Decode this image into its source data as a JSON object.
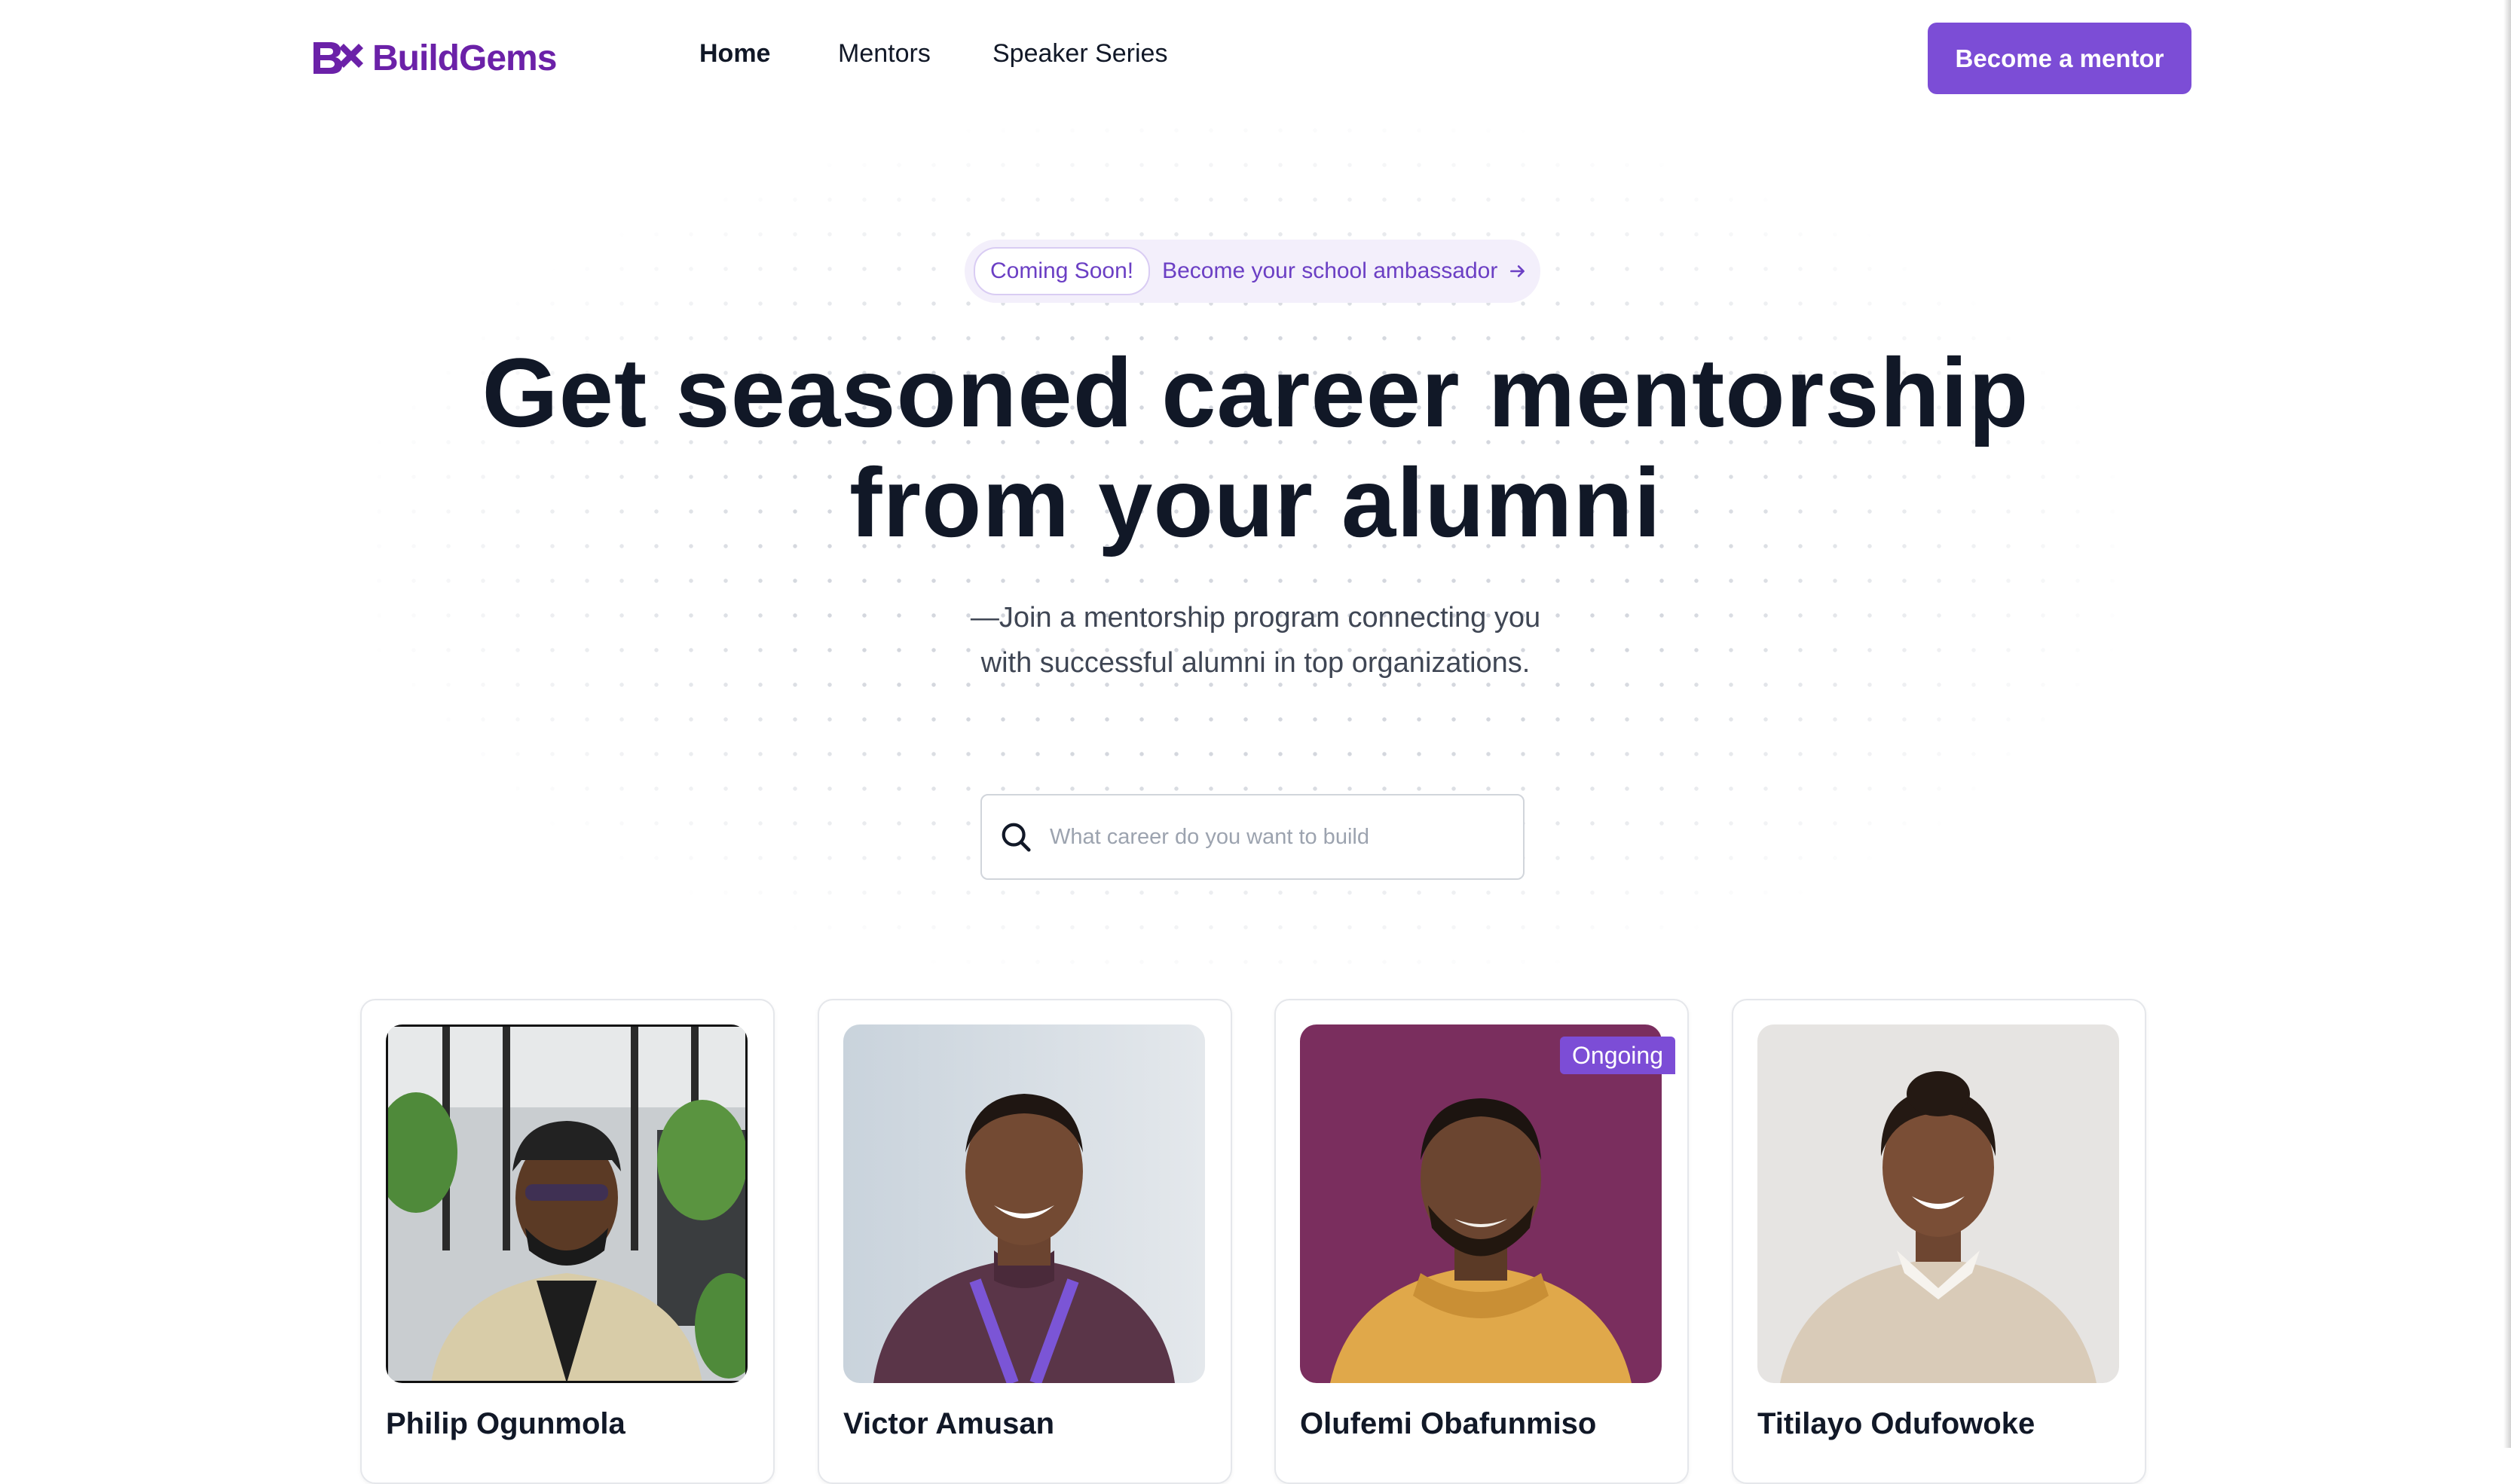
{
  "brand": {
    "name": "BuildGems",
    "color": "#6b21a8",
    "icon": "buildgems-logo-icon"
  },
  "nav": {
    "links": [
      {
        "label": "Home",
        "active": true
      },
      {
        "label": "Mentors",
        "active": false
      },
      {
        "label": "Speaker Series",
        "active": false
      }
    ],
    "cta_label": "Become a mentor",
    "accent": "#7c4dd6"
  },
  "badge": {
    "pill": "Coming Soon!",
    "text": "Become your school ambassador",
    "icon": "arrow-right-icon"
  },
  "hero": {
    "title_line1": "Get seasoned career mentorship",
    "title_line2": "from your alumni",
    "subtitle_line1": "—Join a mentorship program connecting you",
    "subtitle_line2": "with successful alumni in top organizations."
  },
  "search": {
    "placeholder": "What career do you want to build",
    "value": "",
    "icon": "search-icon"
  },
  "mentors": [
    {
      "name": "Philip Ogunmola",
      "badge": ""
    },
    {
      "name": "Victor Amusan",
      "badge": ""
    },
    {
      "name": "Olufemi Obafunmiso",
      "badge": "Ongoing"
    },
    {
      "name": "Titilayo Odufowoke",
      "badge": ""
    }
  ]
}
